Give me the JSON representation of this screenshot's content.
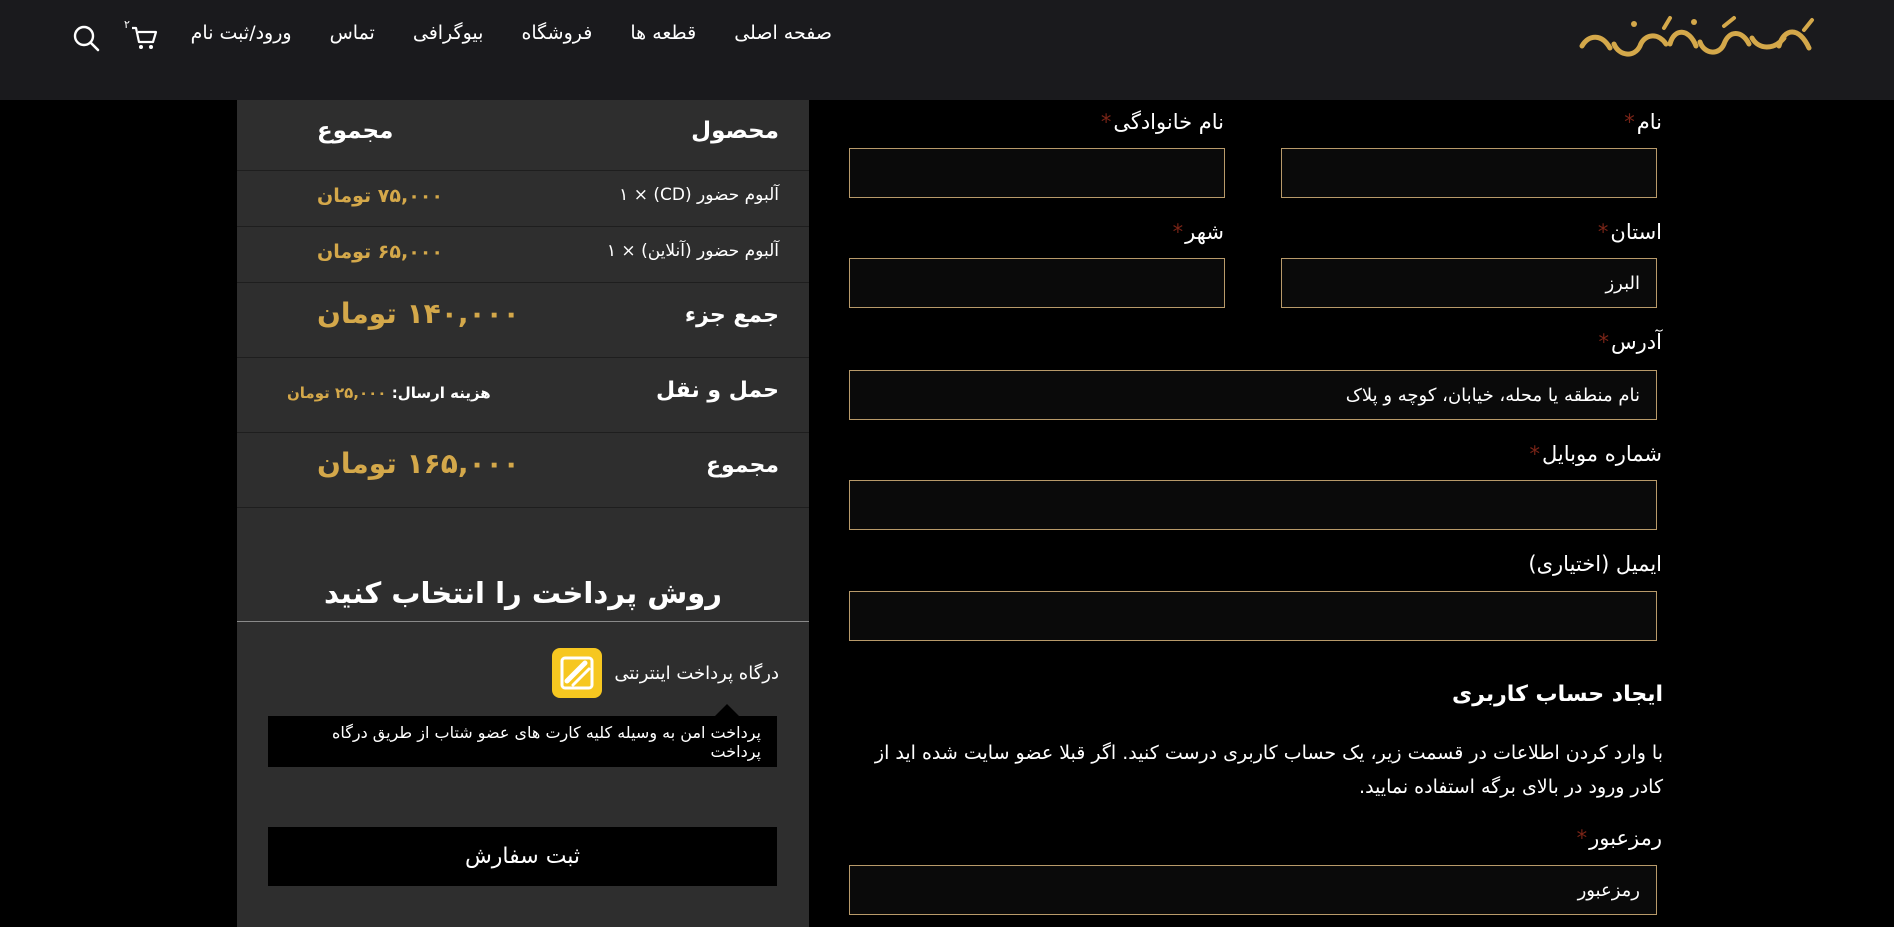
{
  "header": {
    "logo_text": "مسعود سجادی",
    "nav": [
      "صفحه اصلی",
      "قطعه ها",
      "فروشگاه",
      "بیوگرافی",
      "تماس",
      "ورود/ثبت نام"
    ],
    "cart_count": "۲"
  },
  "form": {
    "first_name_label": "نام",
    "last_name_label": "نام خانوادگی",
    "province_label": "استان",
    "province_value": "البرز",
    "city_label": "شهر",
    "address_label": "آدرس",
    "address_placeholder": "نام منطقه یا محله، خیابان، کوچه و پلاک",
    "mobile_label": "شماره موبایل",
    "email_label": "ایمیل (اختیاری)",
    "required_mark": "*",
    "account_title": "ایجاد حساب کاربری",
    "account_text": "با وارد کردن اطلاعات در قسمت زیر، یک حساب کاربری درست کنید. اگر قبلا عضو سایت شده اید از کادر ورود در بالای برگه استفاده نمایید.",
    "password_label": "رمزعبور",
    "password_placeholder": "رمزعبور"
  },
  "order": {
    "product_header": "محصول",
    "total_header": "مجموع",
    "items": [
      {
        "name": "آلبوم حضور (CD)  × ۱",
        "price": "۷۵,۰۰۰ تومان"
      },
      {
        "name": "آلبوم حضور (آنلاین)  × ۱",
        "price": "۶۵,۰۰۰ تومان"
      }
    ],
    "subtotal_label": "جمع جزء",
    "subtotal_value": "۱۴۰,۰۰۰ تومان",
    "shipping_label": "حمل و نقل",
    "shipping_cost_label": "هزینه ارسال:",
    "shipping_cost_value": "۲۵,۰۰۰ تومان",
    "total_label": "مجموع",
    "total_value": "۱۶۵,۰۰۰ تومان",
    "payment_title": "روش پرداخت را انتخاب کنید",
    "gateway_label": "درگاه پرداخت اینترنتی",
    "gateway_description": "پرداخت امن به وسیله کلیه کارت های عضو شتاب از طریق درگاه پرداخت",
    "submit_label": "ثبت سفارش"
  },
  "colors": {
    "accent": "#d4a84a",
    "header_bg": "#1a1a1d",
    "panel_bg": "#2e2e2e",
    "field_border": "#b89a6a",
    "required": "#7a2417",
    "gateway": "#f6c720"
  }
}
